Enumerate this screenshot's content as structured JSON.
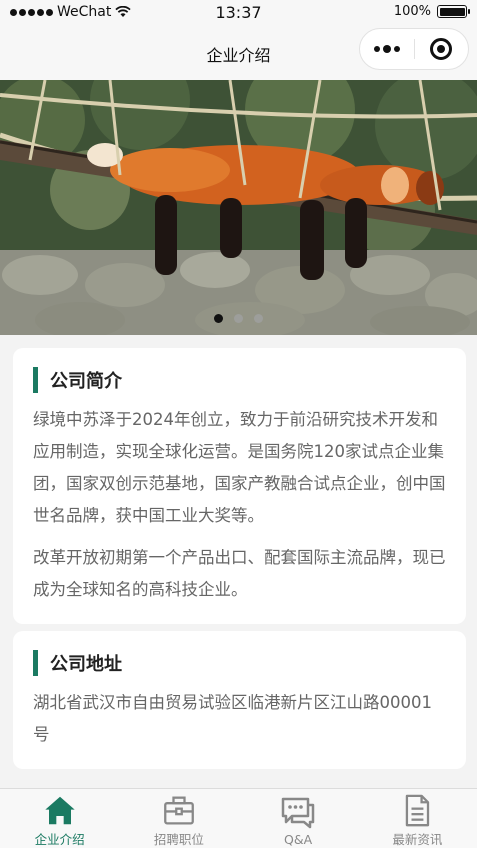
{
  "status_bar": {
    "carrier": "WeChat",
    "time": "13:37",
    "battery": "100%"
  },
  "nav": {
    "title": "企业介绍"
  },
  "banner": {
    "slide_count": 3,
    "active_slide": 1
  },
  "intro": {
    "title": "公司简介",
    "paragraphs": [
      "绿境中苏泽于2024年创立，致力于前沿研究技术开发和应用制造，实现全球化运营。是国务院120家试点企业集团，国家双创示范基地，国家产教融合试点企业，创中国世名品牌，获中国工业大奖等。",
      "改革开放初期第一个产品出口、配套国际主流品牌，现已成为全球知名的高科技企业。"
    ]
  },
  "address": {
    "title": "公司地址",
    "text": "湖北省武汉市自由贸易试验区临港新片区江山路00001号"
  },
  "tabs": [
    {
      "label": "企业介绍",
      "icon": "home-icon",
      "active": true
    },
    {
      "label": "招聘职位",
      "icon": "briefcase-icon",
      "active": false
    },
    {
      "label": "Q&A",
      "icon": "chat-icon",
      "active": false
    },
    {
      "label": "最新资讯",
      "icon": "document-icon",
      "active": false
    }
  ],
  "colors": {
    "accent": "#1b7a62",
    "inactive_icon": "#888888"
  }
}
